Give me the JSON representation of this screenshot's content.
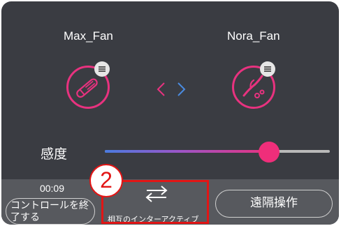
{
  "users": {
    "left": {
      "name": "Max_Fan",
      "device_icon": "rod-vibrator-icon"
    },
    "right": {
      "name": "Nora_Fan",
      "device_icon": "rabbit-vibrator-icon"
    }
  },
  "link_icon": "bidirectional-arrows-icon",
  "sensitivity": {
    "label": "感度",
    "value": 0.73
  },
  "bottom": {
    "timer": "00:09",
    "end_control": "コントロールを終了する",
    "mutual_interactive": "相互のインターアクティブ",
    "remote_control": "遠隔操作"
  },
  "annotation": {
    "step": "2"
  },
  "colors": {
    "accent": "#e8327f",
    "bg": "#3a3c42",
    "bar": "#57595e",
    "highlight": "#e21515"
  }
}
